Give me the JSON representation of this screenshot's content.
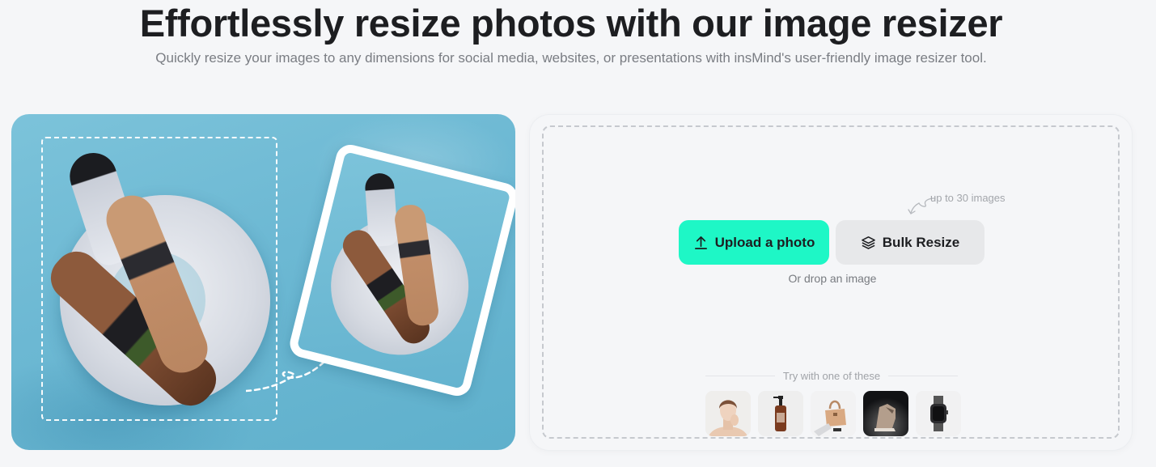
{
  "hero": {
    "title": "Effortlessly resize photos with our image resizer",
    "subtitle": "Quickly resize your images to any dimensions for social media, websites, or presentations with insMind's user-friendly image resizer tool."
  },
  "illustration": {
    "description": "Before/after resize illustration: two women on an inflatable swan float in a pool, with a dashed crop frame and a rotated resized photo card",
    "colors": {
      "water": "#6cb8d3",
      "frame": "#ffffff"
    }
  },
  "upload": {
    "hint": "up to 30 images",
    "upload_button": {
      "label": "Upload a photo",
      "icon": "upload-icon"
    },
    "bulk_button": {
      "label": "Bulk Resize",
      "icon": "layers-icon"
    },
    "drop_text": "Or drop an image",
    "samples_label": "Try with one of these",
    "samples": [
      {
        "name": "woman-portrait"
      },
      {
        "name": "cosmetic-bottle"
      },
      {
        "name": "handbag"
      },
      {
        "name": "sneaker"
      },
      {
        "name": "smartwatch"
      }
    ],
    "colors": {
      "accent": "#1ef7c6",
      "secondary": "#e7e8ea",
      "dashed_border": "#c6c9ce"
    }
  }
}
